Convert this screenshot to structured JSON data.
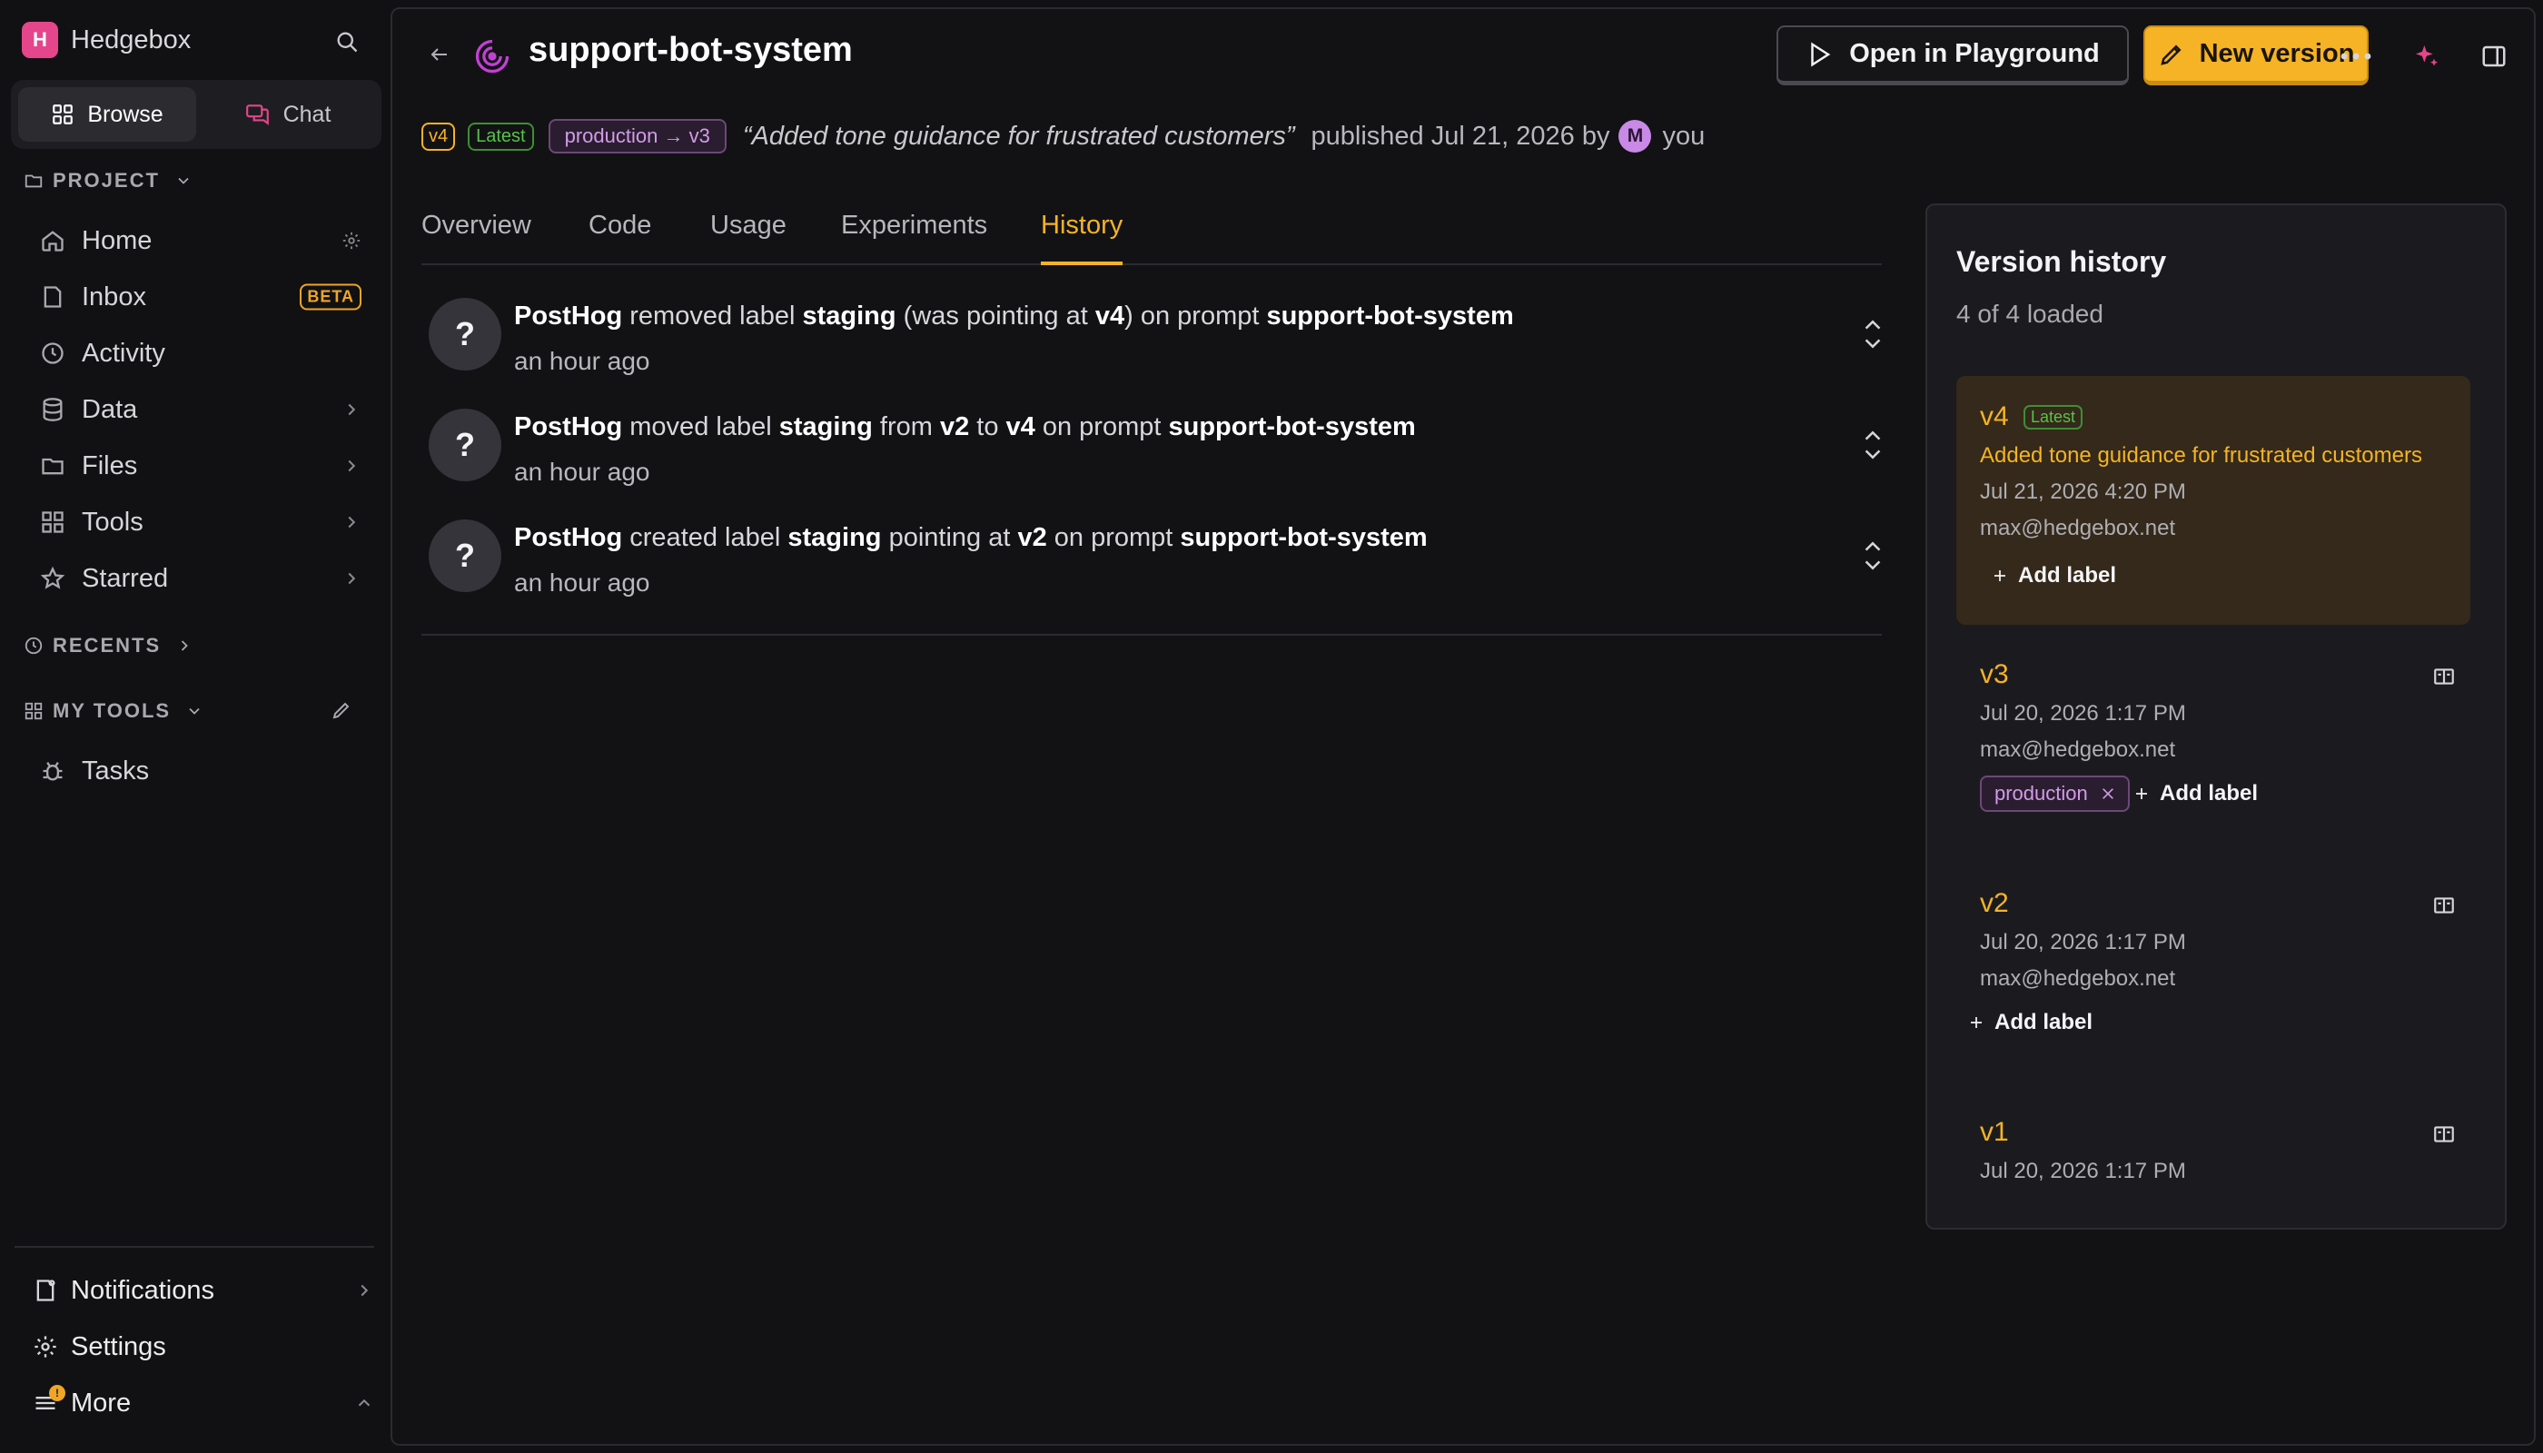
{
  "sidebar": {
    "brand_letter": "H",
    "brand_name": "Hedgebox",
    "segments": {
      "browse": "Browse",
      "chat": "Chat"
    },
    "project_label": "PROJECT",
    "items": [
      {
        "label": "Home",
        "icon": "home-icon"
      },
      {
        "label": "Inbox",
        "icon": "inbox-icon",
        "badge": "BETA"
      },
      {
        "label": "Activity",
        "icon": "clock-icon"
      },
      {
        "label": "Data",
        "icon": "database-icon"
      },
      {
        "label": "Files",
        "icon": "folder-icon"
      },
      {
        "label": "Tools",
        "icon": "grid-icon"
      },
      {
        "label": "Starred",
        "icon": "star-icon"
      }
    ],
    "recents_label": "RECENTS",
    "mytools_label": "MY TOOLS",
    "tools_items": [
      {
        "label": "Tasks",
        "icon": "bug-icon"
      }
    ],
    "footer": {
      "notifications": "Notifications",
      "settings": "Settings",
      "more": "More",
      "more_badge": "!"
    }
  },
  "header": {
    "title": "support-bot-system",
    "open_playground": "Open in Playground",
    "new_version": "New version"
  },
  "meta": {
    "version": "v4",
    "latest": "Latest",
    "production": "production → v3",
    "message": "“Added tone guidance for frustrated customers”",
    "published": "published Jul 21, 2026 by",
    "avatar_letter": "M",
    "author": "you"
  },
  "tabs": [
    "Overview",
    "Code",
    "Usage",
    "Experiments",
    "History"
  ],
  "active_tab": "History",
  "history": [
    {
      "avatar": "?",
      "actor": "PostHog",
      "t1": " removed label ",
      "label": "staging",
      "t2": " (was pointing at ",
      "v1": "v4",
      "t3": ") on prompt ",
      "prompt": "support-bot-system",
      "time": "an hour ago"
    },
    {
      "avatar": "?",
      "actor": "PostHog",
      "t1": " moved label ",
      "label": "staging",
      "t2": " from ",
      "v1": "v2",
      "t3": " to ",
      "v2": "v4",
      "t4": " on prompt ",
      "prompt": "support-bot-system",
      "time": "an hour ago"
    },
    {
      "avatar": "?",
      "actor": "PostHog",
      "t1": " created label ",
      "label": "staging",
      "t2": " pointing at ",
      "v1": "v2",
      "t3": " on prompt ",
      "prompt": "support-bot-system",
      "time": "an hour ago"
    }
  ],
  "version_history": {
    "title": "Version history",
    "count": "4 of 4 loaded",
    "add_label": "Add label",
    "versions": [
      {
        "name": "v4",
        "latest": "Latest",
        "description": "Added tone guidance for frustrated customers",
        "date": "Jul 21, 2026 4:20 PM",
        "email": "max@hedgebox.net"
      },
      {
        "name": "v3",
        "date": "Jul 20, 2026 1:17 PM",
        "email": "max@hedgebox.net",
        "label": "production"
      },
      {
        "name": "v2",
        "date": "Jul 20, 2026 1:17 PM",
        "email": "max@hedgebox.net"
      },
      {
        "name": "v1",
        "date": "Jul 20, 2026 1:17 PM"
      }
    ]
  },
  "colors": {
    "accent": "#f5b325",
    "background": "#111113",
    "success": "#58c24a",
    "label_purple": "#d39be8",
    "brand": "#e5458b"
  }
}
